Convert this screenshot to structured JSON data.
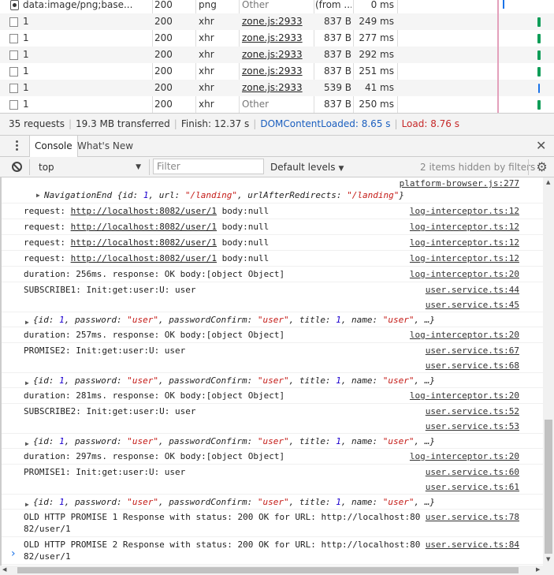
{
  "network": {
    "rows": [
      {
        "name": "data:image/png;base...",
        "status": "200",
        "type": "png",
        "initiator": "Other",
        "size": "(from ...",
        "time": "0 ms",
        "bar_color": "#1a73e8"
      },
      {
        "name": "1",
        "status": "200",
        "type": "xhr",
        "initiator": "zone.js:2933",
        "size": "837 B",
        "time": "249 ms",
        "bar_color": "#0f9d58"
      },
      {
        "name": "1",
        "status": "200",
        "type": "xhr",
        "initiator": "zone.js:2933",
        "size": "837 B",
        "time": "277 ms",
        "bar_color": "#0f9d58"
      },
      {
        "name": "1",
        "status": "200",
        "type": "xhr",
        "initiator": "zone.js:2933",
        "size": "837 B",
        "time": "292 ms",
        "bar_color": "#0f9d58"
      },
      {
        "name": "1",
        "status": "200",
        "type": "xhr",
        "initiator": "zone.js:2933",
        "size": "837 B",
        "time": "251 ms",
        "bar_color": "#0f9d58"
      },
      {
        "name": "1",
        "status": "200",
        "type": "xhr",
        "initiator": "zone.js:2933",
        "size": "539 B",
        "time": "41 ms",
        "bar_color": "#1a73e8"
      },
      {
        "name": "1",
        "status": "200",
        "type": "xhr",
        "initiator": "Other",
        "size": "837 B",
        "time": "250 ms",
        "bar_color": "#0f9d58"
      }
    ]
  },
  "summary": {
    "requests": "35 requests",
    "transferred": "19.3 MB transferred",
    "finish": "Finish: 12.37 s",
    "dcl": "DOMContentLoaded: 8.65 s",
    "load": "Load: 8.76 s",
    "separator": "|"
  },
  "drawer": {
    "tabs": [
      "Console",
      "What's New"
    ],
    "close": "✕"
  },
  "toolbar": {
    "context": "top",
    "filter_placeholder": "Filter",
    "levels": "Default levels",
    "hidden": "2 items hidden by filters",
    "dropdown_glyph": "▼"
  },
  "console": {
    "nav": {
      "src": "platform-browser.js:277",
      "body_prefix": "NavigationEnd {id: ",
      "id": "1",
      "mid1": ", url: ",
      "url": "\"/landing\"",
      "mid2": ", urlAfterRedirects: ",
      "redirect": "\"/landing\"",
      "suffix": "}"
    },
    "requests": [
      {
        "prefix": "request: ",
        "url": "http://localhost:8082/user/1",
        "suffix": " body:null",
        "src": "log-interceptor.ts:12"
      },
      {
        "prefix": "request: ",
        "url": "http://localhost:8082/user/1",
        "suffix": " body:null",
        "src": "log-interceptor.ts:12"
      },
      {
        "prefix": "request: ",
        "url": "http://localhost:8082/user/1",
        "suffix": " body:null",
        "src": "log-interceptor.ts:12"
      },
      {
        "prefix": "request: ",
        "url": "http://localhost:8082/user/1",
        "suffix": " body:null",
        "src": "log-interceptor.ts:12"
      }
    ],
    "groups": [
      {
        "duration": "duration: 256ms. response: OK body:[object Object]",
        "duration_src": "log-interceptor.ts:20",
        "label": "SUBSCRIBE1: Init:get:user:U: user",
        "label_src": "user.service.ts:44",
        "obj_src": "user.service.ts:45"
      },
      {
        "duration": "duration: 257ms. response: OK body:[object Object]",
        "duration_src": "log-interceptor.ts:20",
        "label": "PROMISE2: Init:get:user:U: user",
        "label_src": "user.service.ts:67",
        "obj_src": "user.service.ts:68"
      },
      {
        "duration": "duration: 281ms. response: OK body:[object Object]",
        "duration_src": "log-interceptor.ts:20",
        "label": "SUBSCRIBE2: Init:get:user:U: user",
        "label_src": "user.service.ts:52",
        "obj_src": "user.service.ts:53"
      },
      {
        "duration": "duration: 297ms. response: OK body:[object Object]",
        "duration_src": "log-interceptor.ts:20",
        "label": "PROMISE1: Init:get:user:U: user",
        "label_src": "user.service.ts:60",
        "obj_src": "user.service.ts:61"
      }
    ],
    "object": {
      "open": "{id: ",
      "id": "1",
      "p1": ", password: ",
      "password": "\"user\"",
      "p2": ", passwordConfirm: ",
      "passwordConfirm": "\"user\"",
      "p3": ", title: ",
      "title": "1",
      "p4": ", name: ",
      "name": "\"user\"",
      "close": ", …}"
    },
    "old": [
      {
        "prefix": "OLD HTTP PROMISE 1 Response with status: 200 OK for URL: ",
        "url": "http://localhost:8082/user/1",
        "src": "user.service.ts:78"
      },
      {
        "prefix": "OLD HTTP PROMISE 2 Response with status: 200 OK for URL: ",
        "url": "http://localhost:8082/user/1",
        "src": "user.service.ts:84"
      }
    ],
    "prompt": "›"
  }
}
